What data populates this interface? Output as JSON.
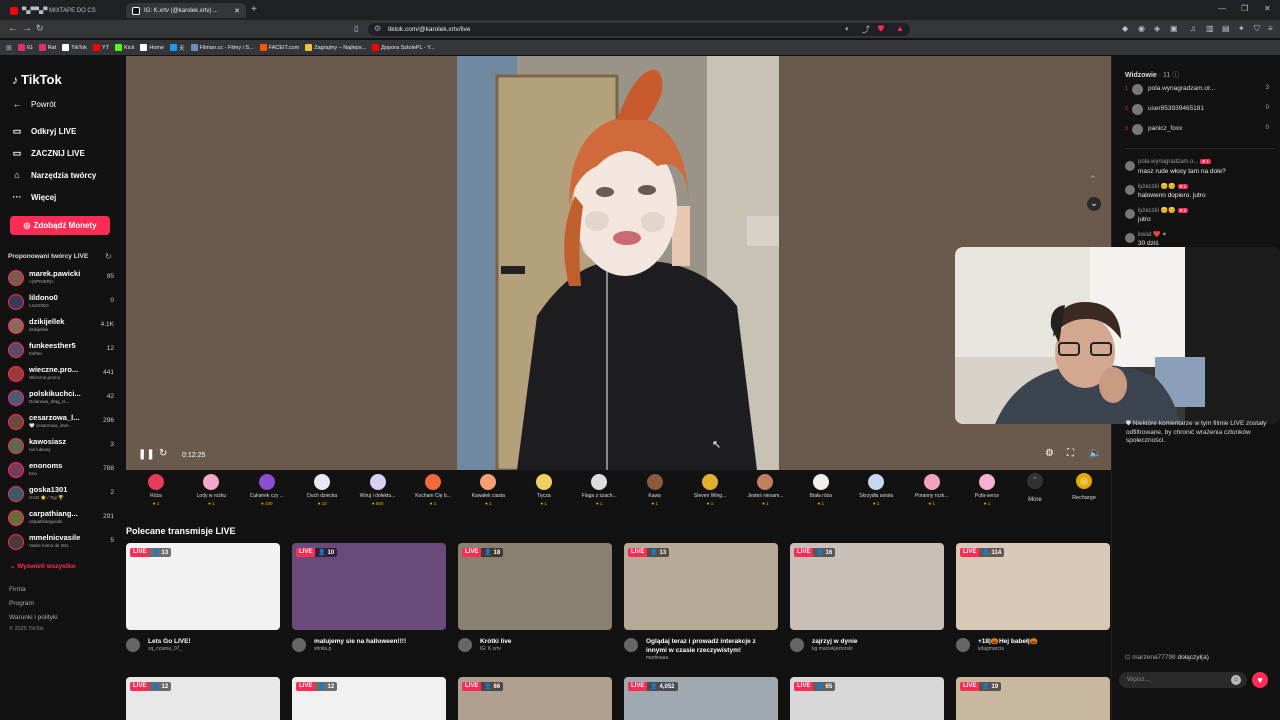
{
  "browser": {
    "tabs": [
      {
        "label": "▀▄▀▀▄▀ MIXTAPE DO CS",
        "color": "#ff0000"
      },
      {
        "label": "IG: K.xrtv (@karolek.xrtv) ...",
        "color": "#ffffff"
      }
    ],
    "url": "tiktok.com/@karolek.xrtv/live",
    "bookmarks": [
      {
        "label": "IG",
        "color": "#e1306c"
      },
      {
        "label": "Rat",
        "color": "#e1306c"
      },
      {
        "label": "TikTok",
        "color": "#ffffff"
      },
      {
        "label": "YT",
        "color": "#ff0000"
      },
      {
        "label": "Kick",
        "color": "#53fc18"
      },
      {
        "label": "Home",
        "color": "#ffffff"
      },
      {
        "label": "天",
        "color": "#1d9bf0"
      },
      {
        "label": "Filman.cc - Filmy i S...",
        "color": "#6c8ebf"
      },
      {
        "label": "FACEIT.com",
        "color": "#ff5500"
      },
      {
        "label": "Zagrajmy – Najleps...",
        "color": "#f0c040"
      },
      {
        "label": "Дорога SztolePL - Y...",
        "color": "#ff0000"
      }
    ]
  },
  "sidebar": {
    "logo": "TikTok",
    "back": "Powrót",
    "nav": [
      "Odkryj LIVE",
      "ZACZNIJ LIVE",
      "Narzędzia twórcy",
      "Więcej"
    ],
    "coins_button": "Zdobądź Monety",
    "suggested_title": "Proponowani twórcy LIVE",
    "creators": [
      {
        "name": "marek.pawicki",
        "sub": "<(SPINER)>",
        "count": "95"
      },
      {
        "name": "lildono0",
        "sub": "LILDONO",
        "count": "0"
      },
      {
        "name": "dzikijellek",
        "sub": "dzikijellek",
        "count": "4.1K"
      },
      {
        "name": "funkeesther5",
        "sub": "Esther",
        "count": "12"
      },
      {
        "name": "wieczne.pro...",
        "sub": "Wieczne.promo",
        "count": "441"
      },
      {
        "name": "polskikuchci...",
        "sub": "Dolarowa_drag_G...",
        "count": "42"
      },
      {
        "name": "cesarzowa_l...",
        "sub": "🤍 cesarzowa_inter...",
        "count": "296"
      },
      {
        "name": "kawosiasz",
        "sub": "nie lubiany",
        "count": "3"
      },
      {
        "name": "enonoms",
        "sub": "Eno",
        "count": "788"
      },
      {
        "name": "goska1301",
        "sub": "HAZI ⭐ / Top 🏆",
        "count": "2"
      },
      {
        "name": "carpathiang...",
        "sub": "carpathiangoods",
        "count": "291"
      },
      {
        "name": "mmelnicvasile",
        "sub": "Vasile Inima de ISU...",
        "count": "5"
      }
    ],
    "see_all": "Wyświetl wszystko",
    "footer": [
      "Firma",
      "Program",
      "Warunki i polityki"
    ],
    "copyright": "© 2025 TikTok"
  },
  "player": {
    "time": "0:12:25"
  },
  "gifts": [
    {
      "name": "Róża",
      "price": "1",
      "color": "#e83a5a"
    },
    {
      "name": "Lody w rożku",
      "price": "1",
      "color": "#f4a6c8"
    },
    {
      "name": "Cukierek czy ...",
      "price": "100",
      "color": "#8a4fd0"
    },
    {
      "name": "Duch dziecka",
      "price": "10",
      "color": "#e8e8f4"
    },
    {
      "name": "Wiruj i dołektu...",
      "price": "500",
      "color": "#d8d0f0"
    },
    {
      "name": "Kocham Cię b...",
      "price": "1",
      "color": "#f06a3a"
    },
    {
      "name": "Kawałek ciasta",
      "price": "1",
      "color": "#f4a070"
    },
    {
      "name": "Tęcza",
      "price": "1",
      "color": "#f0d060"
    },
    {
      "name": "Flaga z szach...",
      "price": "1",
      "color": "#dddddd"
    },
    {
      "name": "Kawa",
      "price": "1",
      "color": "#8a5a3a"
    },
    {
      "name": "Steven Wing...",
      "price": "1",
      "color": "#e0b030"
    },
    {
      "name": "Jesteś niesam...",
      "price": "1",
      "color": "#c08060"
    },
    {
      "name": "Biała róża",
      "price": "1",
      "color": "#f0f0e8"
    },
    {
      "name": "Skrzydła anioła",
      "price": "1",
      "color": "#c8d8f0"
    },
    {
      "name": "Poranny rozk...",
      "price": "1",
      "color": "#f4a0c0"
    },
    {
      "name": "Pufa-serce",
      "price": "1",
      "color": "#f4b0d0"
    }
  ],
  "more_label": "More",
  "recharge_label": "Recharge",
  "recommended": {
    "title": "Polecane transmisje LIVE",
    "live_label": "LIVE",
    "cards": [
      {
        "viewers": "13",
        "title": "Lets Go LIVE!",
        "user": "xq_czarna_07_",
        "bg": "#f2f2f2"
      },
      {
        "viewers": "10",
        "title": "malujemy sie na halloween!!!!",
        "user": "shnila.p",
        "bg": "#6a4a7a"
      },
      {
        "viewers": "18",
        "title": "Krótki live",
        "user": "IG: K.xrtv",
        "bg": "#8a8070"
      },
      {
        "viewers": "13",
        "title": "Oglądaj teraz i prowadź interakcje z innymi w czasie rzeczywistym!",
        "user": "martinaaa",
        "bg": "#b8aa98"
      },
      {
        "viewers": "16",
        "title": "zajrzyj w dynie",
        "user": "kg maciekjeziorski",
        "bg": "#c8c0b8"
      },
      {
        "viewers": "114",
        "title": "+18|🎃Hej babeł|🎃",
        "user": "kdagmarcia",
        "bg": "#d8c8b8"
      }
    ],
    "row2": [
      {
        "viewers": "12",
        "bg": "#e8e8e8"
      },
      {
        "viewers": "12",
        "bg": "#f0f0f0"
      },
      {
        "viewers": "66",
        "bg": "#b0a090"
      },
      {
        "viewers": "4,052",
        "bg": "#a0a8b0"
      },
      {
        "viewers": "65",
        "bg": "#d8d8d8"
      },
      {
        "viewers": "19",
        "bg": "#c8b8a0"
      }
    ]
  },
  "chat": {
    "viewers_label": "Widzowie",
    "viewers_count": "· 11",
    "top_viewers": [
      {
        "rank": "1",
        "name": "pola.wynagradzam.or...",
        "score": "3"
      },
      {
        "rank": "2",
        "name": "user853939465181",
        "score": "0"
      },
      {
        "rank": "3",
        "name": "panicz_foxx",
        "score": "0"
      }
    ],
    "messages": [
      {
        "user": "pola.wynagradzam.o...",
        "badge": "1",
        "text": "masz rude włosy tam na dole?"
      },
      {
        "user": "łyżeczki 😊😊",
        "badge": "1",
        "text": "halowenn dopiero. jutro"
      },
      {
        "user": "łyżeczki 😊😊",
        "badge": "2",
        "text": "jutro"
      },
      {
        "user": "kwiat ❤️ ♥",
        "badge": "",
        "text": "30 dziś"
      }
    ],
    "notice": "Niektóre komentarze w tym filmie LIVE zostały odfiltrowane, by chronić wrażenia członków społeczności.",
    "joined_user": "marzena77798",
    "joined_text": "dołączył(a)",
    "input_placeholder": "Wpisz..."
  }
}
